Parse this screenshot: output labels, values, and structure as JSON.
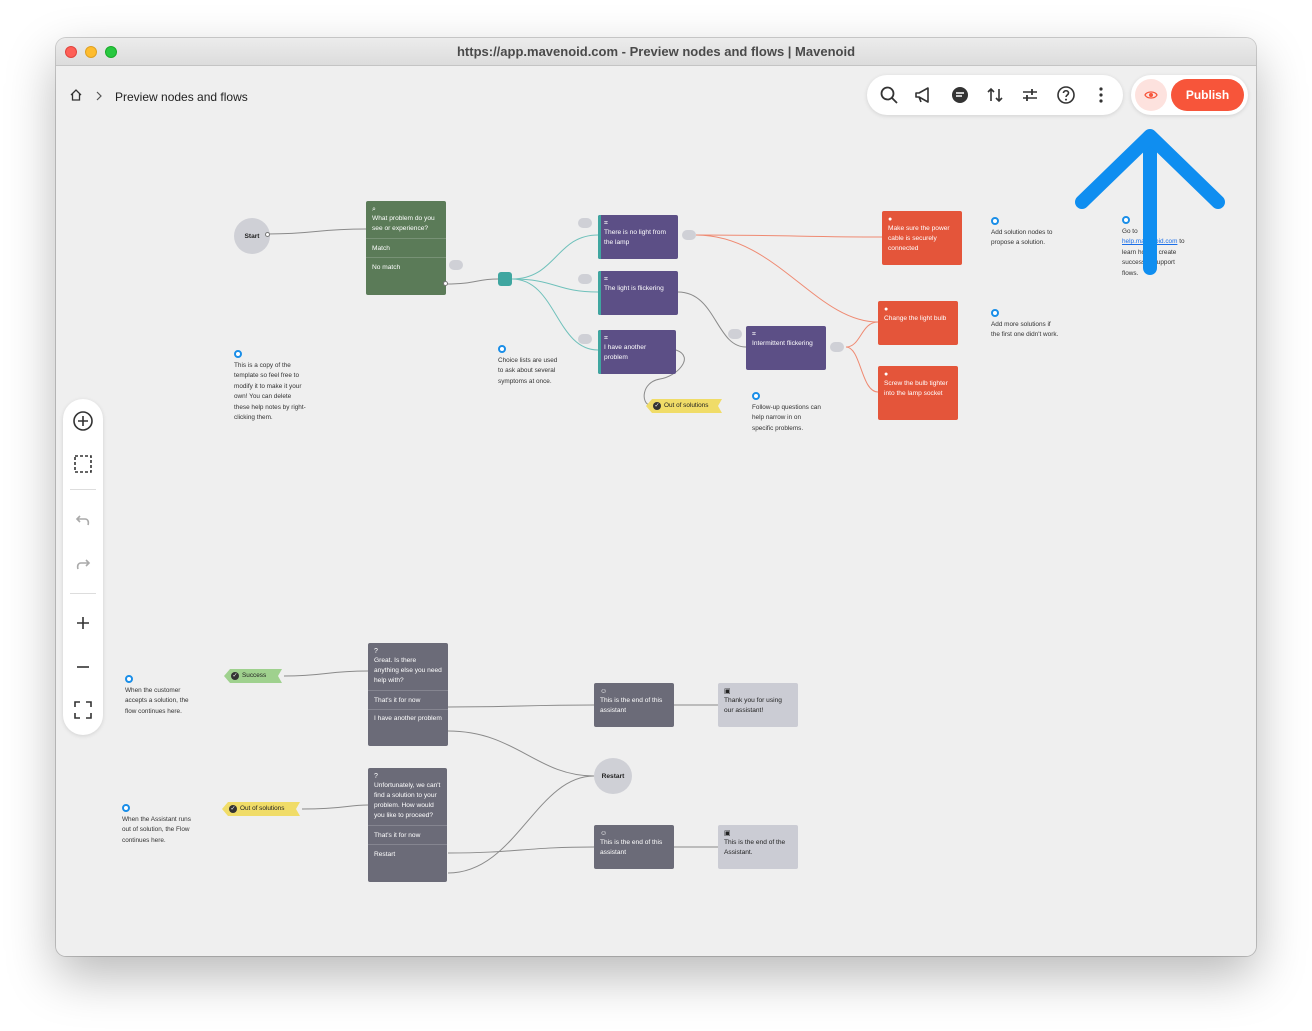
{
  "window": {
    "title": "https://app.mavenoid.com - Preview nodes and flows | Mavenoid"
  },
  "breadcrumb": {
    "title": "Preview nodes and flows"
  },
  "toolbar": {
    "icons": [
      "search-icon",
      "megaphone-icon",
      "chat-icon",
      "sort-icon",
      "sliders-icon",
      "help-icon",
      "more-icon"
    ],
    "publish_label": "Publish",
    "accent": "#f7553a"
  },
  "flow": {
    "start": "Start",
    "q1": {
      "text": "What problem do you see or experience?",
      "match": "Match",
      "no_match": "No match"
    },
    "choice_a": "There is no light from the lamp",
    "choice_b": "The light is flickering",
    "choice_c": "I have another problem",
    "intermittent": "Intermittent flickering",
    "sol1": "Make sure the power cable is securely connected",
    "sol2": "Change the light bulb",
    "sol3": "Screw the bulb tighter into the lamp socket",
    "oos_tag_top": "Out of solutions",
    "success_tag": "Success",
    "oos_tag_bottom": "Out of solutions",
    "great": {
      "text": "Great. Is there anything else you need help with?",
      "opt1": "That's it for now",
      "opt2": "I have another problem"
    },
    "unfortunately": {
      "text": "Unfortunately, we can't find a solution to your problem. How would you like to proceed?",
      "opt1": "That's it for now",
      "opt2": "Restart"
    },
    "end1": "This is the end of this assistant",
    "end2": "This is the end of this assistant",
    "thanks": "Thank you for using our assistant!",
    "end_final": "This is the end of the Assistant.",
    "restart": "Restart"
  },
  "notes": {
    "copy": "This is a copy of the template so feel free to modify it to make it your own! You can delete these help notes by right-clicking them.",
    "choice": "Choice lists are used to ask about several symptoms at once.",
    "followup": "Follow-up questions can help narrow in on specific problems.",
    "add_solution": "Add solution nodes to propose a solution.",
    "add_more": "Add more solutions if the first one didn't work.",
    "goto_pre": "Go to",
    "goto_link": "help.mavenoid.com",
    "goto_post": "to learn how to create successful support flows.",
    "customer": "When the customer accepts a solution, the flow continues here.",
    "assistant": "When the Assistant runs out of solution, the Flow continues here."
  },
  "colors": {
    "question": "#5b7b58",
    "choice": "#5c4f86",
    "solution": "#e4553a",
    "outcome": "#6b6b78",
    "note_dot": "#1a8ee8",
    "arrow": "#0f8ef0"
  }
}
